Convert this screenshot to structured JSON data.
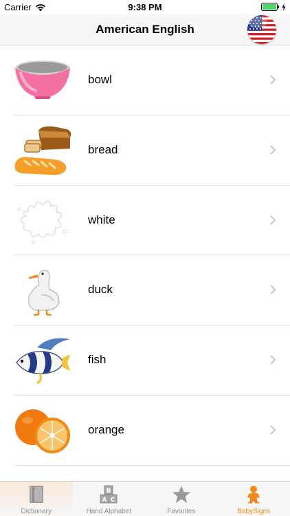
{
  "status_bar": {
    "carrier": "Carrier",
    "time": "9:38 PM",
    "battery_color": "#4cd964"
  },
  "nav": {
    "title": "American English",
    "flag_icon": "us-flag-icon"
  },
  "items": [
    {
      "label": "bowl",
      "icon": "bowl-icon"
    },
    {
      "label": "bread",
      "icon": "bread-icon"
    },
    {
      "label": "white",
      "icon": "white-splash-icon"
    },
    {
      "label": "duck",
      "icon": "duck-icon"
    },
    {
      "label": "fish",
      "icon": "fish-icon"
    },
    {
      "label": "orange",
      "icon": "orange-icon"
    }
  ],
  "tabs": [
    {
      "label": "Dictionary",
      "icon": "book-icon"
    },
    {
      "label": "Hand Alphabet",
      "icon": "abc-blocks-icon"
    },
    {
      "label": "Favorites",
      "icon": "star-icon"
    },
    {
      "label": "BabySigns",
      "icon": "baby-icon",
      "active": true
    }
  ],
  "accent_color": "#f08a1c"
}
